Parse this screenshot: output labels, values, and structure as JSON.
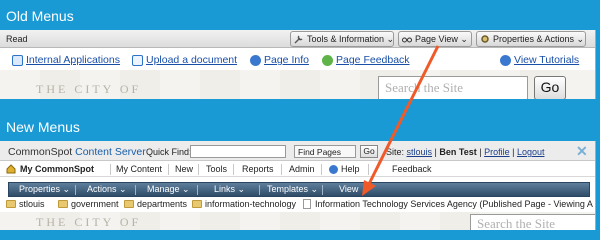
{
  "old_section": {
    "title": "Old Menus",
    "read_label": "Read",
    "menus": {
      "tools": "Tools & Information ⌄",
      "page_view": "Page View ⌄",
      "properties": "Properties & Actions ⌄"
    },
    "links": {
      "apps": "Internal Applications",
      "upload": "Upload a document",
      "info": "Page Info",
      "feedback": "Page Feedback",
      "tutorials": "View Tutorials"
    },
    "city_text": "THE CITY OF",
    "search_placeholder": "Search the Site",
    "go_label": "Go"
  },
  "new_section": {
    "title": "New Menus",
    "brand_part1": "CommonSpot",
    "brand_part2": " Content Server",
    "quick_find_label": "Quick Find:",
    "find_select_value": "Find Pages",
    "go_label": "Go",
    "site_label": "Site:",
    "site_link": "stlouis",
    "user_name": "Ben Test",
    "profile_link": "Profile",
    "logout_link": "Logout",
    "nav": {
      "my_commonspot": "My CommonSpot",
      "my_content": "My Content",
      "new": "New",
      "tools": "Tools",
      "reports": "Reports",
      "admin": "Admin",
      "help": "Help",
      "feedback": "Feedback"
    },
    "menus": {
      "properties": "Properties ⌄",
      "actions": "Actions ⌄",
      "manage": "Manage ⌄",
      "links": "Links ⌄",
      "templates": "Templates ⌄",
      "view": "View ⌄"
    },
    "breadcrumbs": {
      "stlouis": "stlouis",
      "government": "government",
      "departments": "departments",
      "it": "information-technology",
      "page": "Information Technology Services Agency (Published Page - Viewing A"
    },
    "city_text": "THE CITY OF",
    "search_placeholder": "Search the Site"
  },
  "colors": {
    "background": "#1a9ad4",
    "arrow": "#f05a28",
    "menubar": "#3d5a78"
  }
}
